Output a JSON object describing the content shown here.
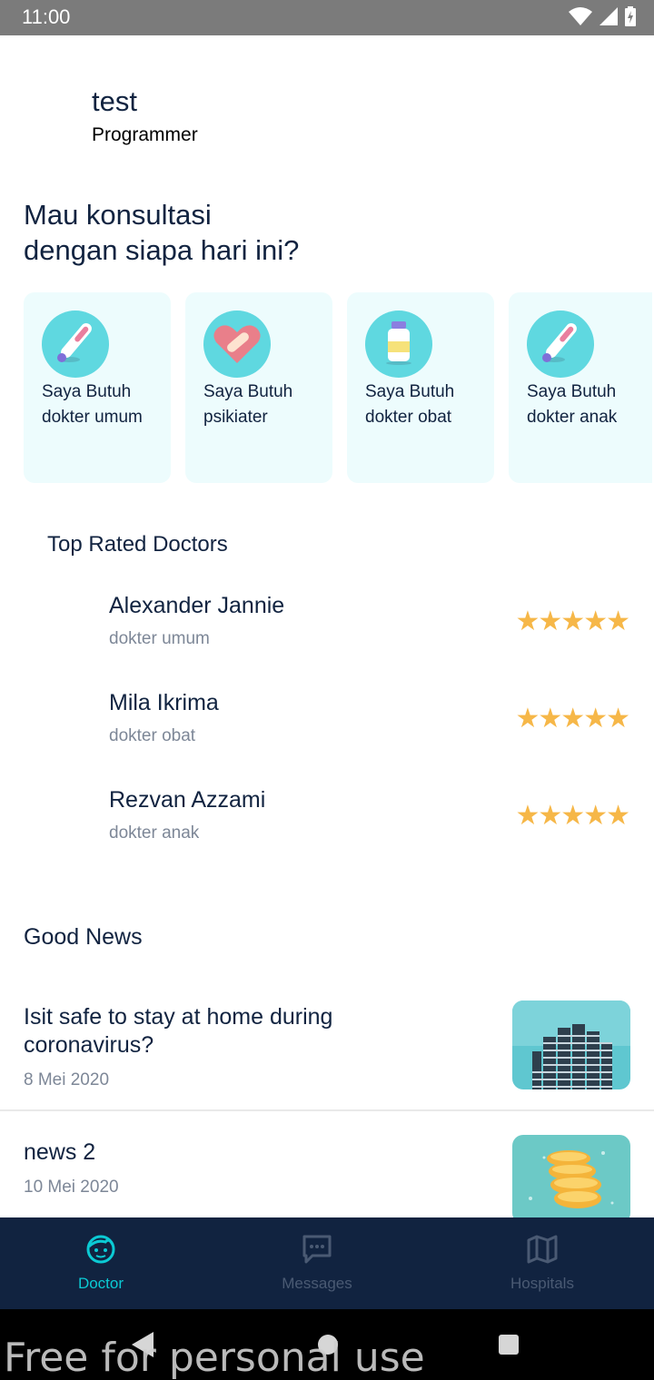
{
  "status_bar": {
    "time": "11:00"
  },
  "profile": {
    "name": "test",
    "role": "Programmer"
  },
  "welcome": "Mau konsultasi\ndengan siapa hari ini?",
  "categories": [
    {
      "line1": "Saya Butuh",
      "line2": "dokter umum",
      "icon": "thermometer-icon"
    },
    {
      "line1": "Saya Butuh",
      "line2": "psikiater",
      "icon": "heart-bandage-icon"
    },
    {
      "line1": "Saya Butuh",
      "line2": "dokter obat",
      "icon": "medicine-bottle-icon"
    },
    {
      "line1": "Saya Butuh",
      "line2": "dokter anak",
      "icon": "thermometer-icon"
    }
  ],
  "top_rated": {
    "title": "Top Rated Doctors",
    "doctors": [
      {
        "name": "Alexander Jannie",
        "category": "dokter umum",
        "stars": "★★★★★",
        "rating": 5
      },
      {
        "name": "Mila Ikrima",
        "category": "dokter obat",
        "stars": "★★★★★",
        "rating": 5
      },
      {
        "name": "Rezvan Azzami",
        "category": "dokter anak",
        "stars": "★★★★★",
        "rating": 5
      }
    ]
  },
  "news": {
    "title": "Good News",
    "items": [
      {
        "title": "Isit safe to stay at home during coronavirus?",
        "date": "8 Mei 2020",
        "thumb": "building-photo"
      },
      {
        "title": "news 2",
        "date": "10 Mei 2020",
        "thumb": "lemon-photo"
      }
    ]
  },
  "bottom_nav": [
    {
      "label": "Doctor",
      "icon": "doctor-face-icon",
      "active": true
    },
    {
      "label": "Messages",
      "icon": "message-icon",
      "active": false
    },
    {
      "label": "Hospitals",
      "icon": "map-icon",
      "active": false
    }
  ],
  "watermark": "Free for personal use",
  "colors": {
    "primary": "#112340",
    "accent": "#0bcad4",
    "card_bg": "#edfcfd",
    "star": "#f6b748",
    "muted": "#7d8797"
  }
}
